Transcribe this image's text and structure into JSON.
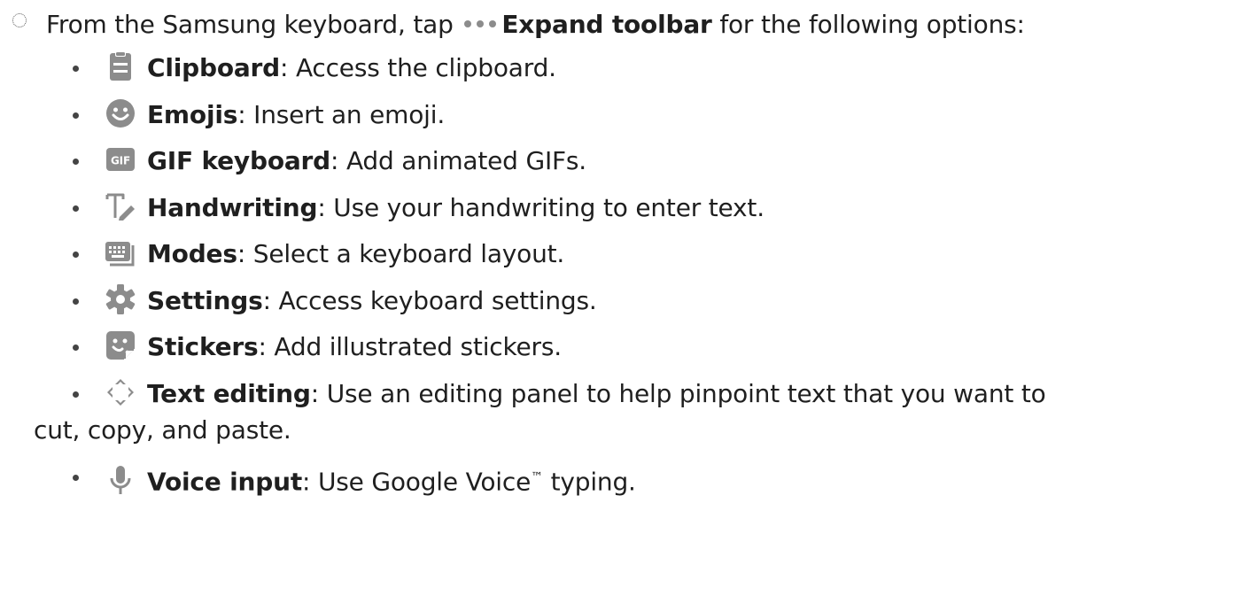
{
  "intro": {
    "pre": "From the Samsung keyboard, tap",
    "icon": "more-dots-icon",
    "action": "Expand toolbar",
    "post": "for the following options:"
  },
  "items": [
    {
      "icon": "clipboard-icon",
      "label": "Clipboard",
      "desc": ": Access the clipboard."
    },
    {
      "icon": "emoji-icon",
      "label": "Emojis",
      "desc": ": Insert an emoji."
    },
    {
      "icon": "gif-icon",
      "label": "GIF keyboard",
      "desc": ": Add animated GIFs."
    },
    {
      "icon": "handwriting-icon",
      "label": "Handwriting",
      "desc": ": Use your handwriting to enter text."
    },
    {
      "icon": "keyboard-modes-icon",
      "label": "Modes",
      "desc": ": Select a keyboard layout."
    },
    {
      "icon": "gear-icon",
      "label": "Settings",
      "desc": ": Access keyboard settings."
    },
    {
      "icon": "sticker-icon",
      "label": "Stickers",
      "desc": ": Add illustrated stickers."
    },
    {
      "icon": "text-editing-arrows-icon",
      "label": "Text editing",
      "desc": ": Use an editing panel to help pinpoint text that you want to",
      "cont": "cut, copy, and paste."
    },
    {
      "icon": "microphone-icon",
      "label": "Voice input",
      "desc_pre": ": Use Google Voice",
      "tm": "™",
      "desc_post": " typing."
    }
  ],
  "colors": {
    "text": "#1f1f1f",
    "icon_gray": "#8c8c8c",
    "gif_bg": "#8c8c8c"
  }
}
